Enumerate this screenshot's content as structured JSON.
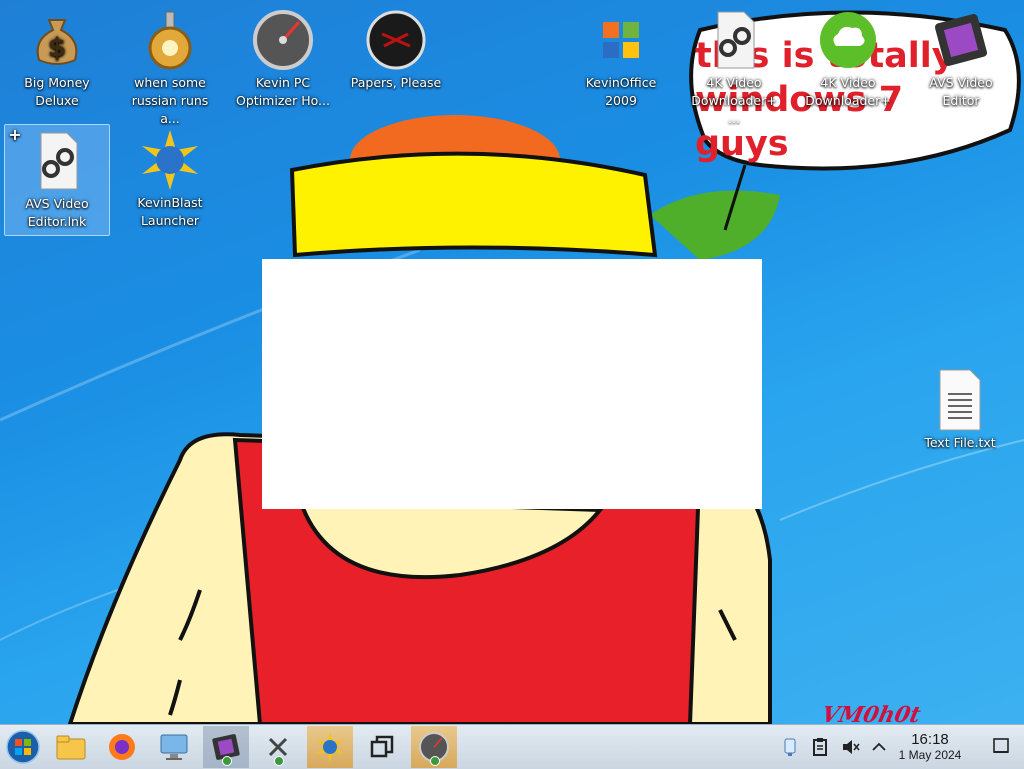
{
  "desktop": {
    "icons": [
      {
        "id": "big-money",
        "label": "Big Money Deluxe",
        "icon": "money-bag-icon"
      },
      {
        "id": "russian",
        "label": "when some russian runs a...",
        "icon": "gear-icon"
      },
      {
        "id": "optimizer",
        "label": "Kevin PC Optimizer Ho...",
        "icon": "speedometer-icon"
      },
      {
        "id": "papers",
        "label": "Papers, Please",
        "icon": "papers-please-icon"
      },
      {
        "id": "kevinoffice",
        "label": "KevinOffice 2009",
        "icon": "office-logo-icon"
      },
      {
        "id": "4k-shortcut",
        "label": "4K Video Downloader+ ...",
        "icon": "shortcut-file-icon"
      },
      {
        "id": "4k",
        "label": "4K Video Downloader+",
        "icon": "download-cloud-icon"
      },
      {
        "id": "avs",
        "label": "AVS Video Editor",
        "icon": "film-strip-icon"
      },
      {
        "id": "avs-lnk",
        "label": "AVS Video Editor.lnk",
        "icon": "shortcut-file-icon"
      },
      {
        "id": "kevinblast",
        "label": "KevinBlast Launcher",
        "icon": "starburst-globe-icon"
      },
      {
        "id": "textfile",
        "label": "Text File.txt",
        "icon": "text-document-icon"
      }
    ],
    "wallpaper_text": "this is totally windows 7 guys",
    "watermark": "VM0h0t"
  },
  "taskbar": {
    "start_icon": "windows-start-icon",
    "pinned": [
      {
        "name": "file-explorer-icon"
      },
      {
        "name": "firefox-icon"
      },
      {
        "name": "computer-settings-icon"
      },
      {
        "name": "film-strip-icon"
      },
      {
        "name": "x-tool-icon"
      },
      {
        "name": "starburst-globe-icon"
      },
      {
        "name": "window-switcher-icon"
      },
      {
        "name": "speedometer-icon"
      }
    ],
    "tray": {
      "icons": [
        "network-icon",
        "clipboard-icon",
        "speaker-muted-icon",
        "chevron-up-icon"
      ],
      "time": "16:18",
      "date": "1 May 2024"
    }
  },
  "colors": {
    "desktop_blue": "#1a8ee3",
    "taskbar_bg": "#d6e0ea",
    "highlight": "#e2b872"
  }
}
